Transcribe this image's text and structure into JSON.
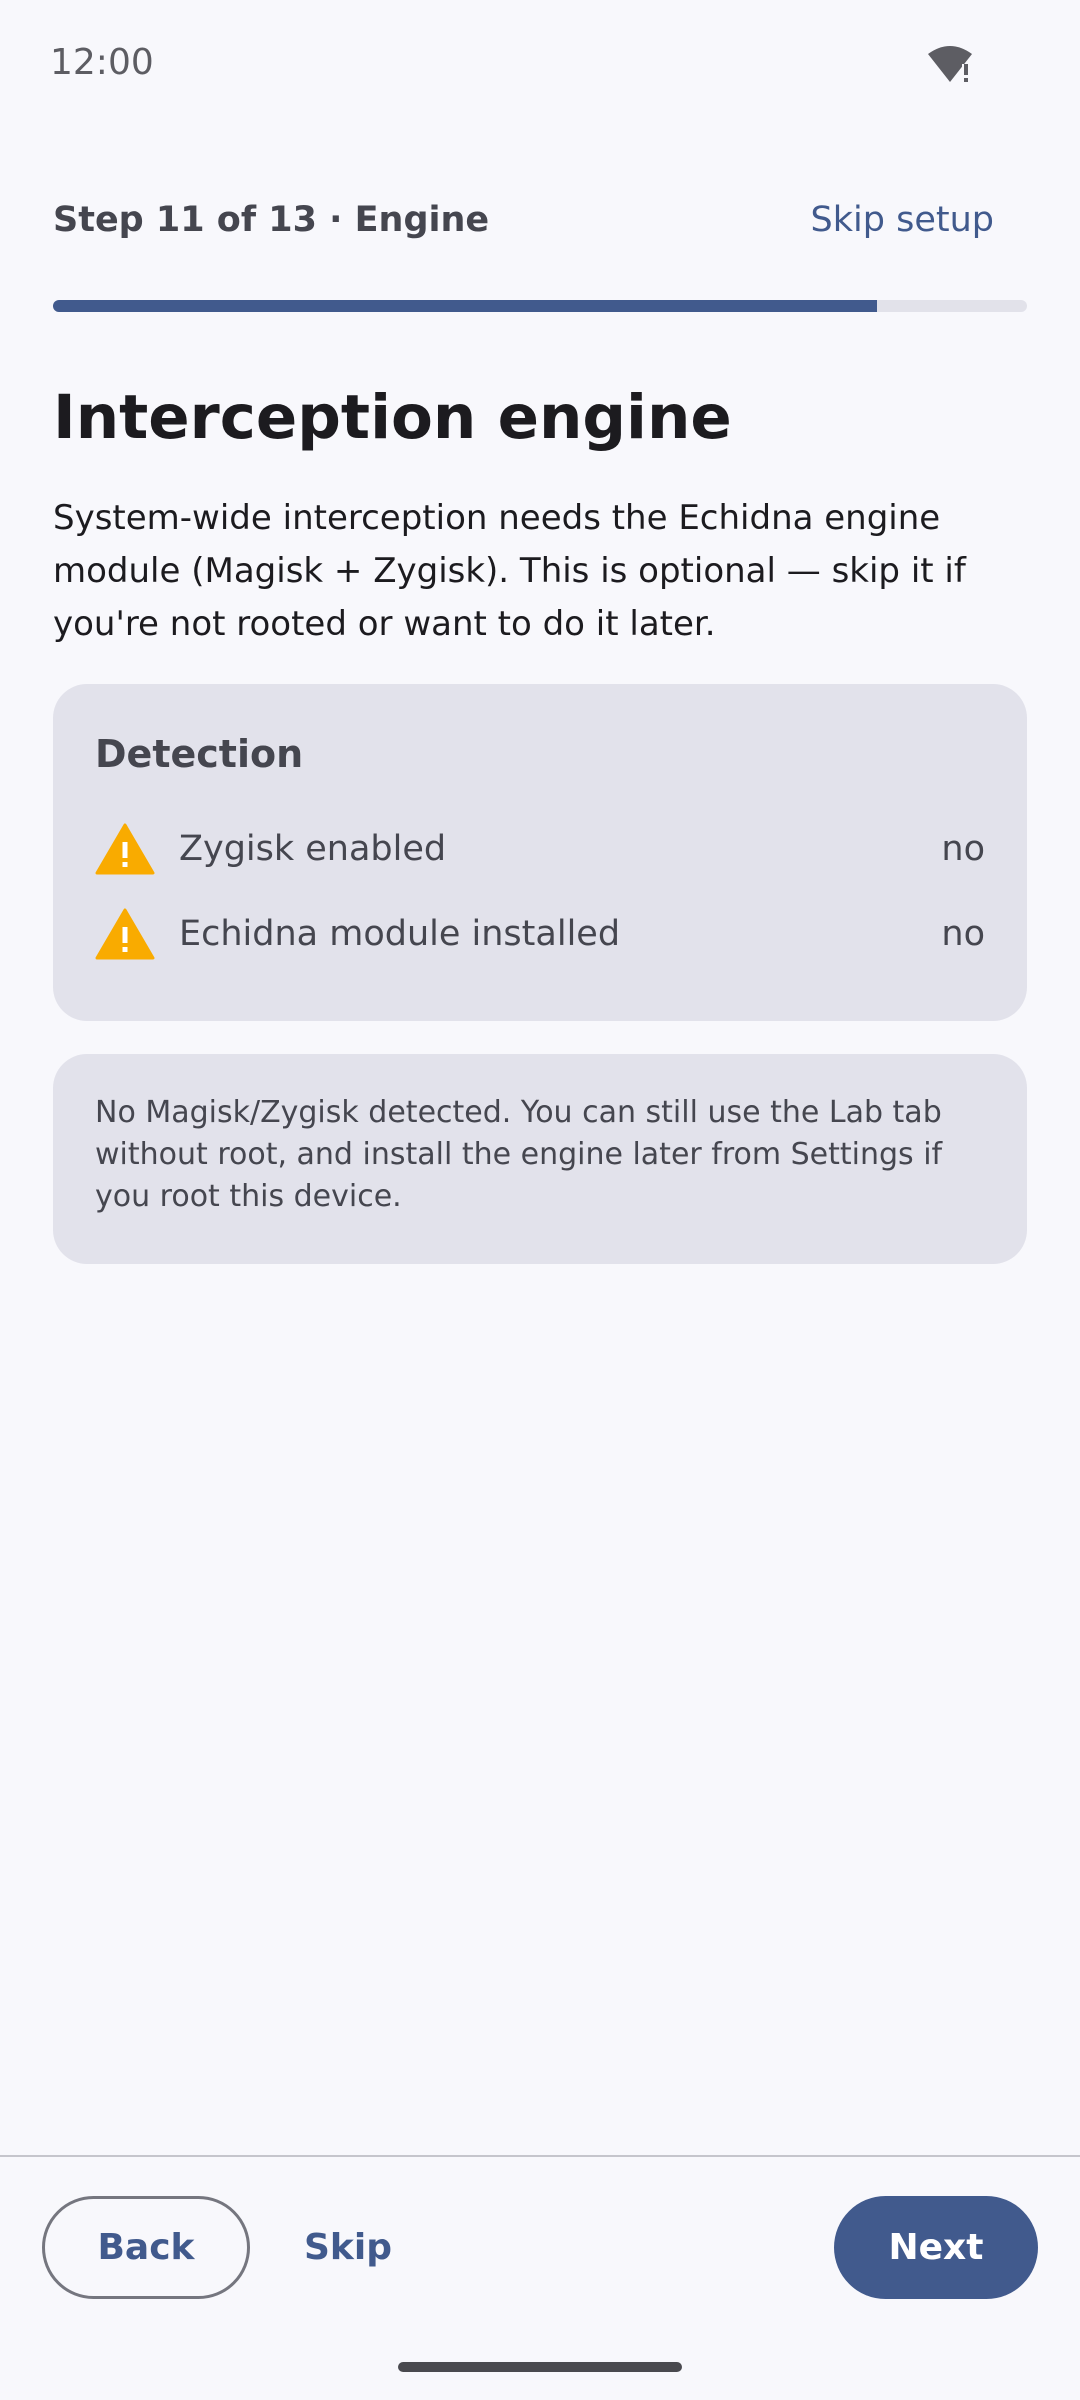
{
  "status_bar": {
    "time": "12:00",
    "wifi_icon": "wifi-alert-icon"
  },
  "header": {
    "step_label": "Step 11 of 13 · Engine",
    "skip_setup_label": "Skip setup",
    "progress_fraction": 0.846
  },
  "main": {
    "title": "Interception engine",
    "description": "System-wide interception needs the Echidna engine module (Magisk + Zygisk). This is optional — skip it if you're not rooted or want to do it later.",
    "detection": {
      "title": "Detection",
      "items": [
        {
          "label": "Zygisk enabled",
          "value": "no",
          "icon": "warning-icon"
        },
        {
          "label": "Echidna module installed",
          "value": "no",
          "icon": "warning-icon"
        }
      ]
    },
    "note": "No Magisk/Zygisk detected. You can still use the Lab tab without root, and install the engine later from Settings if you root this device."
  },
  "footer": {
    "back_label": "Back",
    "skip_label": "Skip",
    "next_label": "Next"
  },
  "colors": {
    "accent": "#415a8d",
    "warning": "#f9ab00",
    "background": "#f8f8fc",
    "card": "#e2e2eb"
  }
}
